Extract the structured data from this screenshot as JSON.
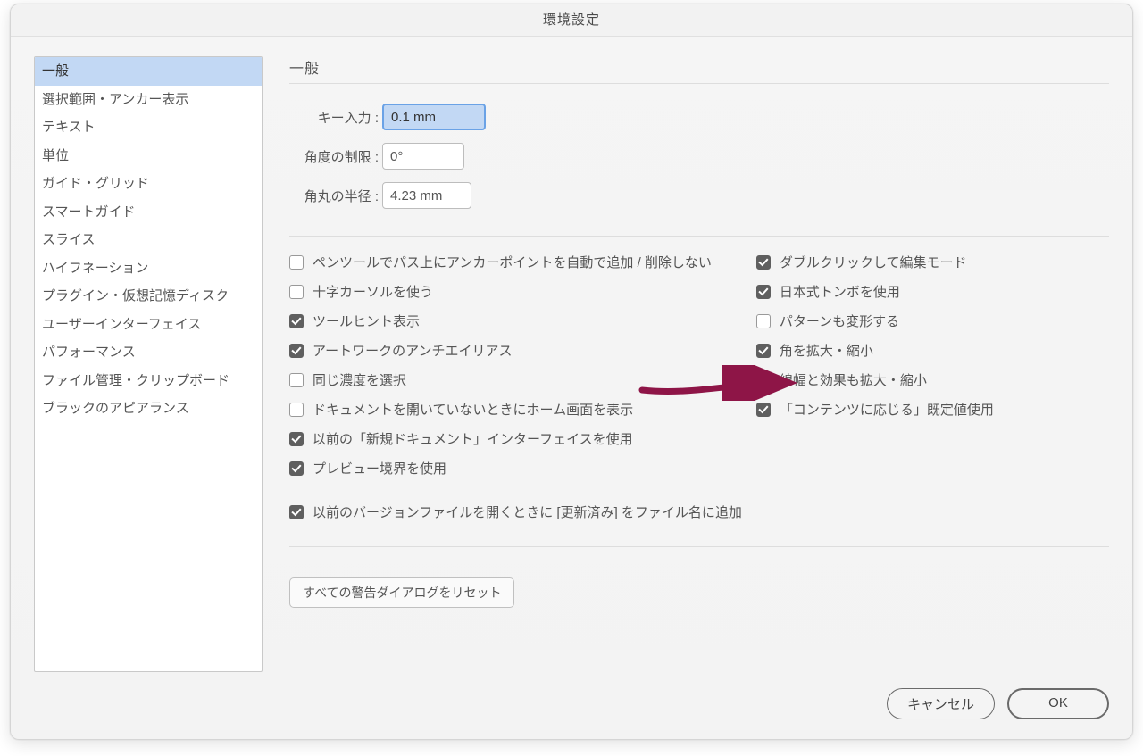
{
  "window": {
    "title": "環境設定"
  },
  "sidebar": {
    "items": [
      "一般",
      "選択範囲・アンカー表示",
      "テキスト",
      "単位",
      "ガイド・グリッド",
      "スマートガイド",
      "スライス",
      "ハイフネーション",
      "プラグイン・仮想記憶ディスク",
      "ユーザーインターフェイス",
      "パフォーマンス",
      "ファイル管理・クリップボード",
      "ブラックのアピアランス"
    ],
    "selected_index": 0
  },
  "section": {
    "title": "一般"
  },
  "form": {
    "key_input_label": "キー入力 :",
    "key_input_value": "0.1 mm",
    "angle_label": "角度の制限 :",
    "angle_value": "0°",
    "corner_label": "角丸の半径 :",
    "corner_value": "4.23 mm"
  },
  "checks_left": [
    {
      "label": "ペンツールでパス上にアンカーポイントを自動で追加 / 削除しない",
      "checked": false
    },
    {
      "label": "十字カーソルを使う",
      "checked": false
    },
    {
      "label": "ツールヒント表示",
      "checked": true
    },
    {
      "label": "アートワークのアンチエイリアス",
      "checked": true
    },
    {
      "label": "同じ濃度を選択",
      "checked": false
    },
    {
      "label": "ドキュメントを開いていないときにホーム画面を表示",
      "checked": false
    },
    {
      "label": "以前の「新規ドキュメント」インターフェイスを使用",
      "checked": true
    },
    {
      "label": "プレビュー境界を使用",
      "checked": true
    }
  ],
  "checks_right": [
    {
      "label": "ダブルクリックして編集モード",
      "checked": true
    },
    {
      "label": "日本式トンボを使用",
      "checked": true
    },
    {
      "label": "パターンも変形する",
      "checked": false
    },
    {
      "label": "角を拡大・縮小",
      "checked": true
    },
    {
      "label": "線幅と効果も拡大・縮小",
      "checked": true
    },
    {
      "label": "「コンテンツに応じる」既定値使用",
      "checked": true
    }
  ],
  "checks_wide": [
    {
      "label": "以前のバージョンファイルを開くときに [更新済み] をファイル名に追加",
      "checked": true
    }
  ],
  "reset_button": "すべての警告ダイアログをリセット",
  "footer": {
    "cancel": "キャンセル",
    "ok": "OK"
  }
}
